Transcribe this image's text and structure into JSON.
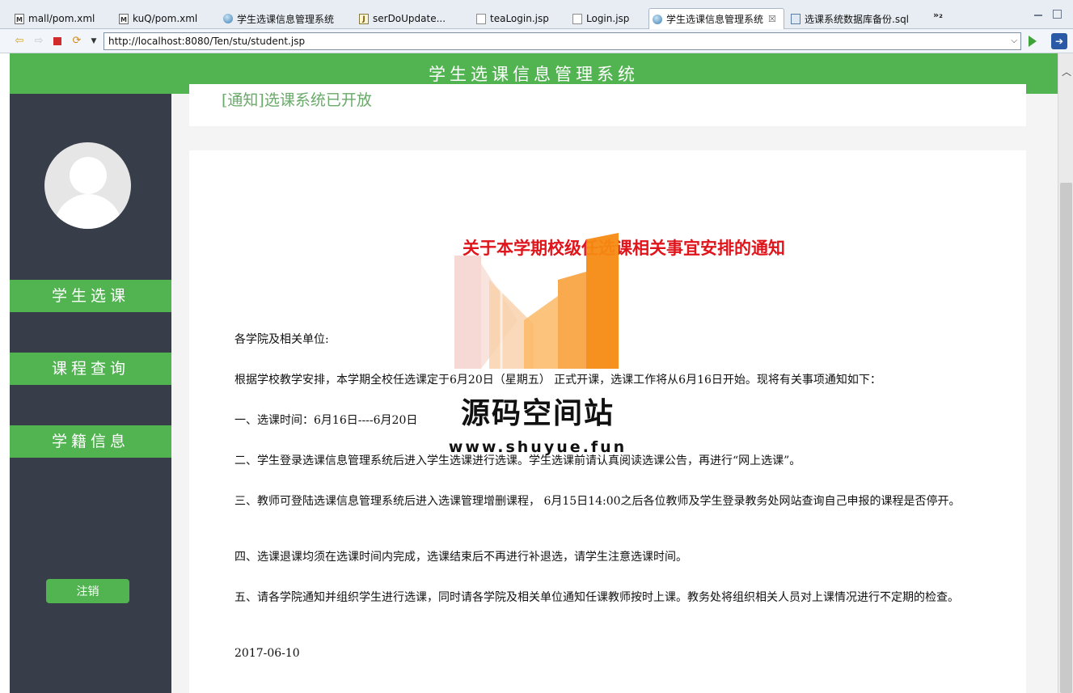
{
  "tabs": [
    {
      "label": "mall/pom.xml",
      "icon": "maven-file-icon"
    },
    {
      "label": "kuQ/pom.xml",
      "icon": "maven-file-icon"
    },
    {
      "label": "学生选课信息管理系统",
      "icon": "globe-icon"
    },
    {
      "label": "serDoUpdate...",
      "icon": "java-file-icon"
    },
    {
      "label": "teaLogin.jsp",
      "icon": "jsp-file-icon"
    },
    {
      "label": "Login.jsp",
      "icon": "jsp-file-icon"
    },
    {
      "label": "学生选课信息管理系统",
      "icon": "globe-icon",
      "active": true,
      "close": "☒"
    },
    {
      "label": "选课系统数据库备份.sql",
      "icon": "sql-file-icon"
    }
  ],
  "overflow_tabs": "»₂",
  "address": {
    "url": "http://localhost:8080/Ten/stu/student.jsp"
  },
  "page": {
    "header_title": "学生选课信息管理系统",
    "notice_link": "[通知]选课系统已开放",
    "sidebar": {
      "items": [
        {
          "label": "学生选课"
        },
        {
          "label": "课程查询"
        },
        {
          "label": "学籍信息"
        }
      ],
      "logout": "注销"
    },
    "document": {
      "title": "关于本学期校级任选课相关事宜安排的通知",
      "paragraphs": [
        "各学院及相关单位:",
        "根据学校教学安排，本学期全校任选课定于6月20日（星期五） 正式开课，选课工作将从6月16日开始。现将有关事项通知如下：",
        "一、选课时间：6月16日----6月20日",
        "二、学生登录选课信息管理系统后进入学生选课进行选课。学生选课前请认真阅读选课公告，再进行“网上选课”。",
        "三、教师可登陆选课信息管理系统后进入选课管理增删课程， 6月15日14:00之后各位教师及学生登录教务处网站查询自己申报的课程是否停开。",
        "四、选课退课均须在选课时间内完成，选课结束后不再进行补退选，请学生注意选课时间。",
        "五、请各学院通知并组织学生进行选课，同时请各学院及相关单位通知任课教师按时上课。教务处将组织相关人员对上课情况进行不定期的检查。",
        "2017-06-10"
      ]
    }
  },
  "watermark": {
    "text": "源码空间站",
    "url": "www.shuyue.fun"
  },
  "colors": {
    "accent_green": "#52b351",
    "sidebar_bg": "#373d49",
    "title_red": "#e0141b",
    "notice_green": "#69a969"
  }
}
